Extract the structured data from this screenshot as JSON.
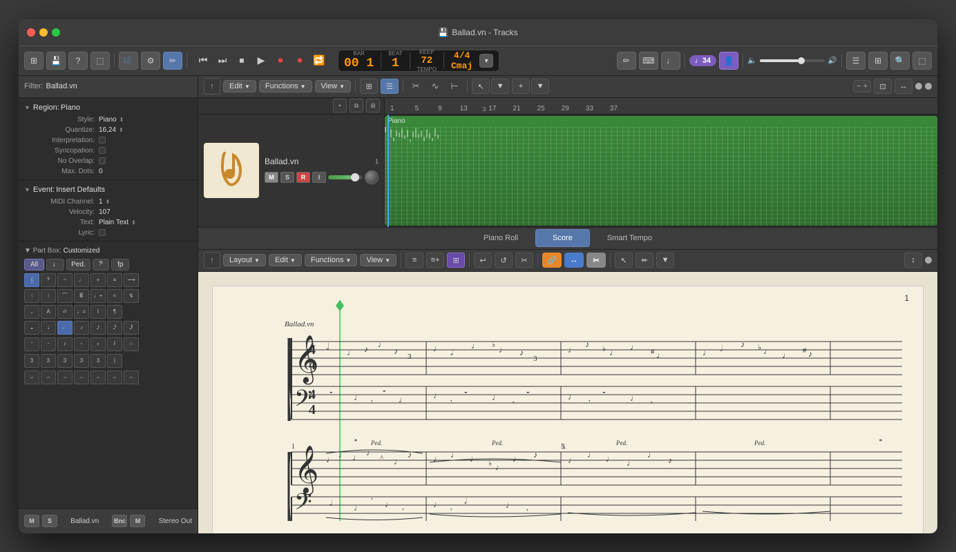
{
  "window": {
    "title": "Ballad.vn - Tracks",
    "traffic_lights": [
      "close",
      "minimize",
      "maximize"
    ]
  },
  "titlebar": {
    "title": "Ballad.vn - Tracks",
    "icon": "💾"
  },
  "top_toolbar": {
    "buttons": [
      "grid",
      "save",
      "help",
      "share",
      "pencil",
      "metronome",
      "mixer",
      "pen-active"
    ],
    "transport": {
      "rewind": "⏮",
      "fast_forward": "⏭",
      "stop": "⏹",
      "play": "▶",
      "record": "⏺",
      "record_alt": "⏺",
      "cycle": "🔁"
    },
    "display": {
      "bar_label": "BAR",
      "bar_value": "00 1",
      "beat_label": "BEAT",
      "beat_value": "1",
      "keep_label": "KEEP",
      "tempo_value": "72",
      "tempo_label": "TEMPO",
      "time_sig": "4/4",
      "key_sig": "Cmaj"
    },
    "right_buttons": [
      "edit",
      "brush",
      "note",
      "user_badge",
      "metronome2"
    ],
    "user_badge": "♩34",
    "volume_slider": true
  },
  "tracks_toolbar": {
    "back_btn": "↑",
    "edit_btn": "Edit",
    "functions_btn": "Functions",
    "view_btn": "View",
    "add_btn": "+",
    "view_modes": [
      "grid",
      "list",
      "scissors",
      "wave",
      "marker"
    ],
    "tool_modes": [
      "pointer",
      "flex",
      "add"
    ],
    "zoom_btns": [
      "-",
      "+"
    ]
  },
  "left_panel": {
    "filter": {
      "label": "Filter:",
      "value": "Ballad.vn"
    },
    "region_section": {
      "title": "Region: Piano",
      "rows": [
        {
          "label": "Style:",
          "value": "Piano",
          "has_arrows": true
        },
        {
          "label": "Quantize:",
          "value": "16,24",
          "has_arrows": true
        },
        {
          "label": "Interpretation:",
          "value": "",
          "has_checkbox": true
        },
        {
          "label": "Syncopation:",
          "value": "",
          "has_checkbox": true
        },
        {
          "label": "No Overlap:",
          "value": "",
          "has_checkbox": true
        },
        {
          "label": "Max. Dots:",
          "value": "0"
        }
      ]
    },
    "event_section": {
      "title": "Event: Insert Defaults",
      "rows": [
        {
          "label": "MIDI Channel:",
          "value": "1",
          "has_arrows": true
        },
        {
          "label": "Velocity:",
          "value": "107"
        },
        {
          "label": "Text:",
          "value": "Plain Text",
          "has_arrows": true
        },
        {
          "label": "Lyric:",
          "value": "",
          "has_checkbox": true
        }
      ]
    },
    "part_box": {
      "title": "Part Box: Customized",
      "categories": [
        "All",
        "♩",
        "Ped.",
        "𝄢",
        "fp"
      ],
      "active_category": "All"
    },
    "bottom_strip": {
      "track_name": "Ballad.vn",
      "output": "Stereo Out",
      "mute_btn": "M",
      "solo_btn": "S",
      "m_btn2": "M",
      "bnc_btn": "Bnc"
    }
  },
  "track_header": {
    "name": "Ballad.vn",
    "number": "1",
    "controls": {
      "mute": "M",
      "solo": "S",
      "record_arm": "R",
      "input": "I"
    }
  },
  "timeline": {
    "markers": [
      1,
      5,
      9,
      13,
      3,
      17,
      21,
      25,
      29,
      33,
      37
    ],
    "piano_label": "Piano"
  },
  "lower_section": {
    "tabs": [
      {
        "id": "piano-roll",
        "label": "Piano Roll",
        "active": false
      },
      {
        "id": "score",
        "label": "Score",
        "active": true
      },
      {
        "id": "smart-tempo",
        "label": "Smart Tempo",
        "active": false
      }
    ],
    "score_toolbar": {
      "back_btn": "↑",
      "layout_btn": "Layout",
      "edit_btn": "Edit",
      "functions_btn": "Functions",
      "view_btn": "View",
      "tool_btns": [
        "≡",
        "≡+",
        "⊞",
        "↩",
        "↺",
        "✂"
      ],
      "color_btns": [
        "orange",
        "blue",
        "gray"
      ],
      "zoom_btns": [
        "↕",
        "⬤"
      ]
    },
    "score": {
      "page_number": "1",
      "piece_title": "Ballad.vn",
      "time_signature": "4/4"
    }
  }
}
